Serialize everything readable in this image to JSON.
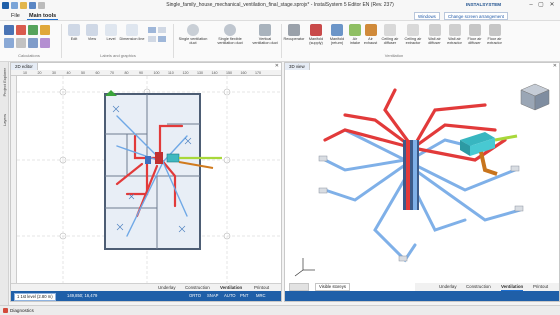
{
  "window": {
    "title": "Single_family_house_mechanical_ventilation_final_stage.sprojx* - InstalSystem 5 Editor EN (Rev. 237)",
    "brand": "INSTALSYSTEM",
    "minimize": "–",
    "maximize": "▢",
    "close": "✕"
  },
  "menu": {
    "file": "File",
    "main_tools": "Main tools",
    "workspace_select": "Windows",
    "arrangement_select": "Change screen arrangement"
  },
  "ribbon": {
    "edit": "Edit",
    "view": "View",
    "level": "Level",
    "dimension_line": "Dimension line",
    "single_duct": "Single ventilation duct",
    "single_flexible_duct": "Single flexible ventilation duct",
    "vertical_duct": "Vertical ventilation duct",
    "recuperator": "Recuperator",
    "manifold_supply": "Manifold (supply)",
    "manifold_return": "Manifold (return)",
    "air_intake": "Air intake",
    "air_exhaust": "Air exhaust",
    "ceiling_air_diffuser": "Ceiling air diffuser",
    "ceiling_air_extractor": "Ceiling air extractor",
    "wall_air_diffuser": "Wall air diffuser",
    "wall_air_extractor": "Wall air extractor",
    "floor_air_diffuser": "Floor air diffuser",
    "floor_air_extractor": "Floor air extractor",
    "group_calculations": "Calculations",
    "group_labels": "Labels and graphics",
    "group_ventilation": "Ventilation"
  },
  "left_strip": {
    "item1": "Project Explorer",
    "item2": "Layers"
  },
  "panel2d": {
    "tab": "2D editor",
    "close": "✕",
    "ruler_marks": [
      "10",
      "20",
      "30",
      "40",
      "50",
      "60",
      "70",
      "80",
      "90",
      "100",
      "110",
      "120",
      "130",
      "140",
      "150",
      "160",
      "170"
    ],
    "view_tabs": {
      "underlay": "Underlay",
      "construction": "Construction",
      "ventilation": "Ventilation",
      "printout": "Printout"
    },
    "status": {
      "level": "1 1st level (2.80 m)",
      "coords": "149,850; 16,479",
      "ortho": "ORTO",
      "snap": "SNAP",
      "auto": "AUTO",
      "pnt": "PNT",
      "mrc": "MRC"
    }
  },
  "panel3d": {
    "tab": "3D view",
    "close": "✕",
    "visible_storeys": "Visible storeys",
    "view_tabs": {
      "underlay": "Underlay",
      "construction": "Construction",
      "ventilation": "Ventilation",
      "printout": "Printout"
    }
  },
  "diagnostics": {
    "label": "Diagnostics"
  },
  "colors": {
    "supply": "#e23a3a",
    "return": "#6fa8e6",
    "exhaust": "#d07a1e",
    "accent": "#1f5fa8"
  }
}
